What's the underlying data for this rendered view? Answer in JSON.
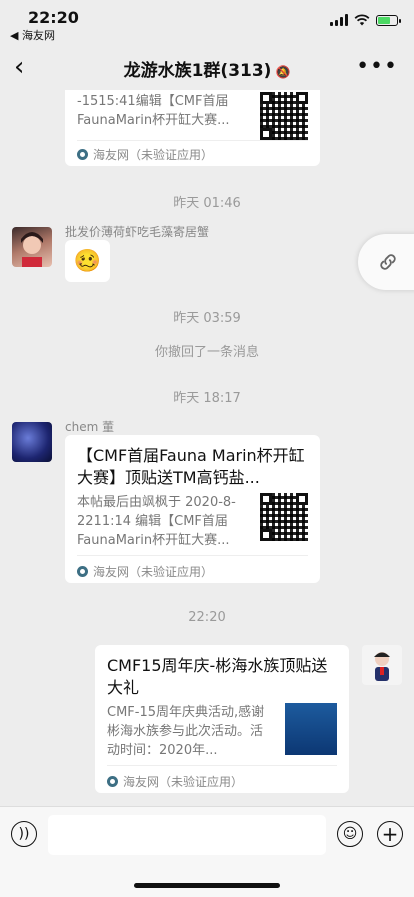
{
  "status_bar": {
    "time": "22:20",
    "back_app": "◀ 海友网"
  },
  "nav": {
    "title": "龙游水族1群(313)"
  },
  "messages": {
    "card0": {
      "desc": "-1515:41编辑【CMF首届FaunaMarin杯开缸大赛...",
      "source": "海友网（未验证应用）"
    },
    "ts1": "昨天 01:46",
    "msg1": {
      "sender": "批发价薄荷虾吃毛藻寄居蟹",
      "sticker": "🥴"
    },
    "ts2": "昨天 03:59",
    "recall": "你撤回了一条消息",
    "ts3": "昨天 18:17",
    "msg2": {
      "sender": "chem 董",
      "title": "【CMF首届Fauna Marin杯开缸大赛】顶贴送TM高钙盐...",
      "desc": "本帖最后由飒枫于 2020-8-2211:14 编辑【CMF首届FaunaMarin杯开缸大赛...",
      "source": "海友网（未验证应用）"
    },
    "ts4": "22:20",
    "msg3": {
      "title": "CMF15周年庆-彬海水族顶贴送大礼",
      "desc": "CMF-15周年庆典活动,感谢彬海水族参与此次活动。活动时间：2020年...",
      "source": "海友网（未验证应用）"
    }
  },
  "colors": {
    "background": "#ededed",
    "bubble": "#ffffff",
    "meta_text": "#9a9a9a",
    "battery": "#4cd964"
  }
}
